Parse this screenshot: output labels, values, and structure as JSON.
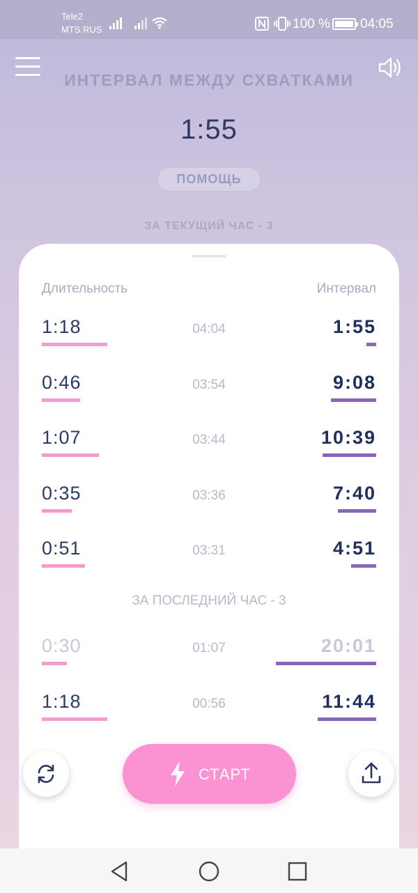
{
  "status_bar": {
    "carrier1": "Tele2",
    "carrier2": "MTS RUS",
    "battery": "100 %",
    "time": "04:05"
  },
  "header": {
    "title": "ИНТЕРВАЛ МЕЖДУ СХВАТКАМИ",
    "current_interval": "1:55",
    "help_label": "ПОМОЩЬ",
    "hour_summary": "ЗА ТЕКУЩИЙ ЧАС - 3"
  },
  "table": {
    "duration_header": "Длительность",
    "interval_header": "Интервал",
    "current_rows": [
      {
        "duration": "1:18",
        "time": "04:04",
        "interval": "1:55",
        "duration_fraction": 0.39,
        "interval_fraction": 0.06
      },
      {
        "duration": "0:46",
        "time": "03:54",
        "interval": "9:08",
        "duration_fraction": 0.23,
        "interval_fraction": 0.27
      },
      {
        "duration": "1:07",
        "time": "03:44",
        "interval": "10:39",
        "duration_fraction": 0.34,
        "interval_fraction": 0.32
      },
      {
        "duration": "0:35",
        "time": "03:36",
        "interval": "7:40",
        "duration_fraction": 0.18,
        "interval_fraction": 0.23
      },
      {
        "duration": "0:51",
        "time": "03:31",
        "interval": "4:51",
        "duration_fraction": 0.26,
        "interval_fraction": 0.15
      }
    ],
    "last_hour_label": "ЗА ПОСЛЕДНИЙ ЧАС - 3",
    "last_hour_rows": [
      {
        "duration": "0:30",
        "time": "01:07",
        "interval": "20:01",
        "duration_fraction": 0.15,
        "interval_fraction": 0.6,
        "faded": true
      },
      {
        "duration": "1:18",
        "time": "00:56",
        "interval": "11:44",
        "duration_fraction": 0.39,
        "interval_fraction": 0.35,
        "faded": false
      }
    ]
  },
  "controls": {
    "start_label": "СТАРТ",
    "reset_icon": "refresh-icon",
    "share_icon": "upload-icon"
  },
  "colors": {
    "duration_bar": "#f59bd0",
    "interval_bar": "#8a66b8",
    "start_button": "#fb92d2",
    "text_dark": "#1f2e5c"
  }
}
